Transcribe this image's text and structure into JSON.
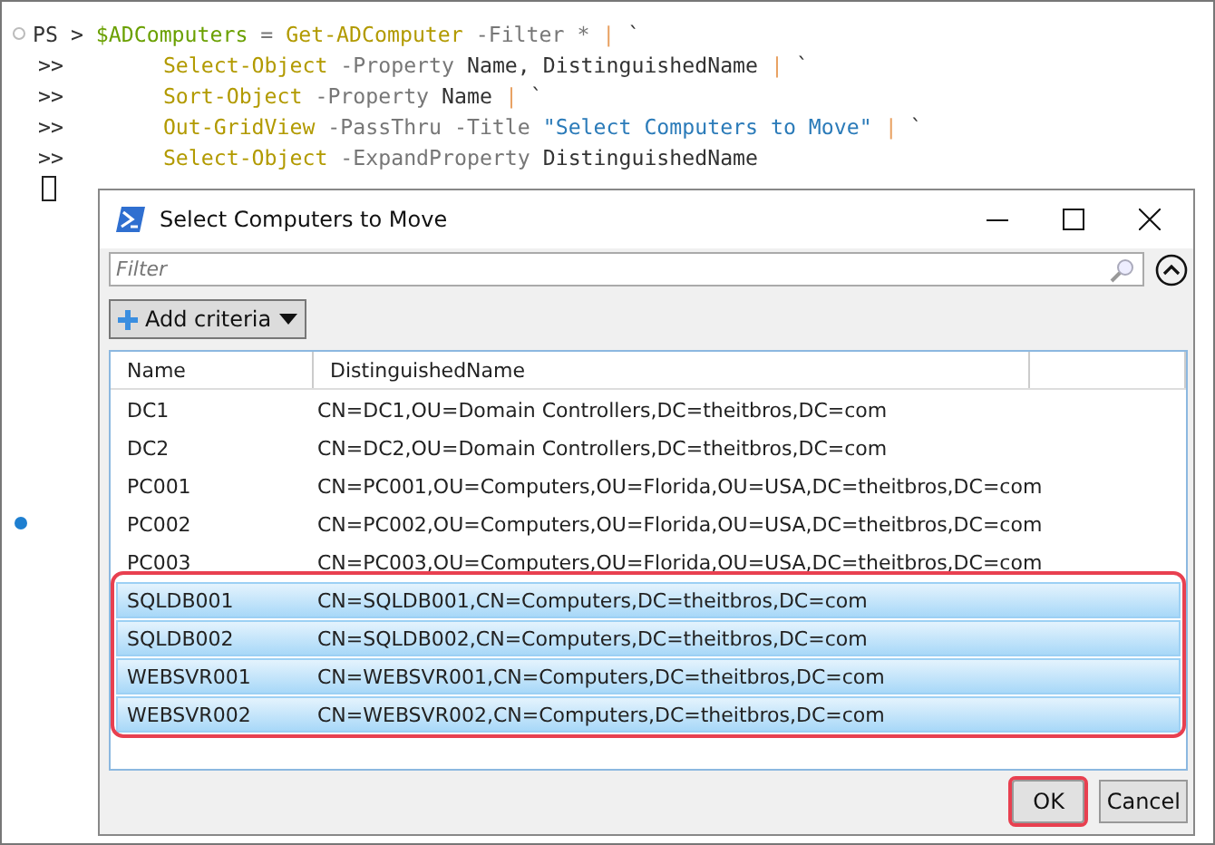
{
  "console": {
    "prompt": "PS >",
    "continuation": ">>",
    "lines": [
      [
        {
          "text": "$ADComputers",
          "kind": "variable"
        },
        {
          "text": " = ",
          "kind": "operator"
        },
        {
          "text": "Get-ADComputer",
          "kind": "command"
        },
        {
          "text": " -Filter",
          "kind": "parameter"
        },
        {
          "text": " * ",
          "kind": "operator"
        },
        {
          "text": "|",
          "kind": "pipe"
        },
        {
          "text": " `",
          "kind": "plain"
        }
      ],
      [
        {
          "text": "   Select-Object",
          "kind": "command"
        },
        {
          "text": " -Property",
          "kind": "parameter"
        },
        {
          "text": " Name, DistinguishedName ",
          "kind": "plain"
        },
        {
          "text": "|",
          "kind": "pipe"
        },
        {
          "text": " `",
          "kind": "plain"
        }
      ],
      [
        {
          "text": "   Sort-Object",
          "kind": "command"
        },
        {
          "text": " -Property",
          "kind": "parameter"
        },
        {
          "text": " Name ",
          "kind": "plain"
        },
        {
          "text": "|",
          "kind": "pipe"
        },
        {
          "text": " `",
          "kind": "plain"
        }
      ],
      [
        {
          "text": "   Out-GridView",
          "kind": "command"
        },
        {
          "text": " -PassThru -Title",
          "kind": "parameter"
        },
        {
          "text": " \"Select Computers to Move\" ",
          "kind": "string"
        },
        {
          "text": "|",
          "kind": "pipe"
        },
        {
          "text": " `",
          "kind": "plain"
        }
      ],
      [
        {
          "text": "   Select-Object",
          "kind": "command"
        },
        {
          "text": " -ExpandProperty",
          "kind": "parameter"
        },
        {
          "text": " DistinguishedName",
          "kind": "plain"
        }
      ]
    ]
  },
  "window": {
    "title": "Select Computers to Move"
  },
  "filter": {
    "placeholder": "Filter"
  },
  "add_criteria_button": "Add criteria",
  "table": {
    "selection_highlighted": true,
    "columns": [
      "Name",
      "DistinguishedName"
    ],
    "rows": [
      {
        "name": "DC1",
        "dn": "CN=DC1,OU=Domain Controllers,DC=theitbros,DC=com",
        "selected": false
      },
      {
        "name": "DC2",
        "dn": "CN=DC2,OU=Domain Controllers,DC=theitbros,DC=com",
        "selected": false
      },
      {
        "name": "PC001",
        "dn": "CN=PC001,OU=Computers,OU=Florida,OU=USA,DC=theitbros,DC=com",
        "selected": false
      },
      {
        "name": "PC002",
        "dn": "CN=PC002,OU=Computers,OU=Florida,OU=USA,DC=theitbros,DC=com",
        "selected": false
      },
      {
        "name": "PC003",
        "dn": "CN=PC003,OU=Computers,OU=Florida,OU=USA,DC=theitbros,DC=com",
        "selected": false
      },
      {
        "name": "SQLDB001",
        "dn": "CN=SQLDB001,CN=Computers,DC=theitbros,DC=com",
        "selected": true
      },
      {
        "name": "SQLDB002",
        "dn": "CN=SQLDB002,CN=Computers,DC=theitbros,DC=com",
        "selected": true
      },
      {
        "name": "WEBSVR001",
        "dn": "CN=WEBSVR001,CN=Computers,DC=theitbros,DC=com",
        "selected": true
      },
      {
        "name": "WEBSVR002",
        "dn": "CN=WEBSVR002,CN=Computers,DC=theitbros,DC=com",
        "selected": true
      }
    ]
  },
  "buttons": [
    {
      "label": "OK",
      "highlighted": true
    },
    {
      "label": "Cancel",
      "highlighted": false
    }
  ]
}
